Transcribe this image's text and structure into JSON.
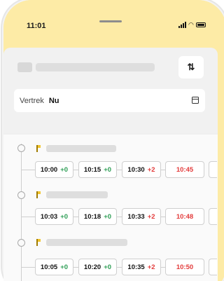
{
  "status_bar": {
    "time": "11:01",
    "wifi_icon": "wifi-icon",
    "battery_icon": "battery-icon"
  },
  "header": {
    "swap_icon_label": "⇅"
  },
  "departure": {
    "label": "Vertrek",
    "value": "Nu"
  },
  "rows": [
    {
      "chips": [
        {
          "time": "10:00",
          "delay": "+0",
          "status": "on-time"
        },
        {
          "time": "10:15",
          "delay": "+0",
          "status": "on-time"
        },
        {
          "time": "10:30",
          "delay": "+2",
          "status": "late"
        },
        {
          "time": "10:45",
          "delay": "",
          "status": "late"
        }
      ]
    },
    {
      "chips": [
        {
          "time": "10:03",
          "delay": "+0",
          "status": "on-time"
        },
        {
          "time": "10:18",
          "delay": "+0",
          "status": "on-time"
        },
        {
          "time": "10:33",
          "delay": "+2",
          "status": "late"
        },
        {
          "time": "10:48",
          "delay": "",
          "status": "late"
        }
      ]
    },
    {
      "chips": [
        {
          "time": "10:05",
          "delay": "+0",
          "status": "on-time"
        },
        {
          "time": "10:20",
          "delay": "+0",
          "status": "on-time"
        },
        {
          "time": "10:35",
          "delay": "+2",
          "status": "late"
        },
        {
          "time": "10:50",
          "delay": "",
          "status": "late"
        }
      ]
    }
  ],
  "colors": {
    "background_accent": "#fdeba6",
    "on_time": "#2e9e55",
    "late": "#e33c3c",
    "flag": "#f1c531"
  }
}
